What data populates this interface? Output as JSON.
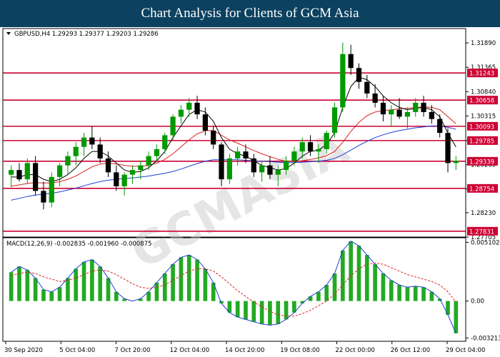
{
  "header": {
    "title": "Chart Analysis for Clients of GCM Asia"
  },
  "watermark": "GCMASIA",
  "colors": {
    "banner": "#0c4160",
    "bull": "#009900",
    "bear": "#000000",
    "sr": "#cc0033",
    "ma_fast": "#000000",
    "ma_mid": "#dd2222",
    "ma_slow": "#1f3fd6",
    "macd": "#1f3fd6",
    "signal": "#dd2222",
    "hist": "#22aa22"
  },
  "chart_data": [
    {
      "type": "candlestick",
      "symbol_label": "GBPUSD,H4  1.29293 1.29377 1.29203 1.29286",
      "ylim": [
        1.27705,
        1.322
      ],
      "y_ticks": [
        "1.31890",
        "1.31365",
        "1.30840",
        "1.30315",
        "1.29785",
        "1.29265",
        "1.28740",
        "1.28230",
        "1.27705"
      ],
      "sr_levels": [
        {
          "value": 1.31243,
          "label": "1.31243"
        },
        {
          "value": 1.30658,
          "label": "1.30658"
        },
        {
          "value": 1.30093,
          "label": "1.30093"
        },
        {
          "value": 1.29785,
          "label": "1.29785"
        },
        {
          "value": 1.29339,
          "label": "1.29339"
        },
        {
          "value": 1.28754,
          "label": "1.28754"
        },
        {
          "value": 1.27831,
          "label": "1.27831"
        }
      ],
      "x_labels": [
        "30 Sep 2020",
        "5 Oct 04:00",
        "7 Oct 20:00",
        "12 Oct 04:00",
        "14 Oct 20:00",
        "19 Oct 08:00",
        "22 Oct 00:00",
        "26 Oct 12:00",
        "29 Oct 04:00"
      ],
      "candles": [
        [
          1.2905,
          1.2925,
          1.2878,
          1.2915
        ],
        [
          1.2915,
          1.293,
          1.289,
          1.2895
        ],
        [
          1.2895,
          1.294,
          1.2885,
          1.293
        ],
        [
          1.293,
          1.2945,
          1.286,
          1.287
        ],
        [
          1.287,
          1.289,
          1.283,
          1.2845
        ],
        [
          1.2845,
          1.291,
          1.2835,
          1.29
        ],
        [
          1.29,
          1.293,
          1.288,
          1.2925
        ],
        [
          1.2925,
          1.2955,
          1.2905,
          1.2945
        ],
        [
          1.2945,
          1.2975,
          1.2925,
          1.2965
        ],
        [
          1.2965,
          1.2995,
          1.2945,
          1.2985
        ],
        [
          1.2985,
          1.301,
          1.296,
          1.297
        ],
        [
          1.297,
          1.2985,
          1.293,
          1.294
        ],
        [
          1.294,
          1.2955,
          1.29,
          1.291
        ],
        [
          1.291,
          1.2925,
          1.287,
          1.288
        ],
        [
          1.288,
          1.291,
          1.286,
          1.2905
        ],
        [
          1.2905,
          1.2925,
          1.2885,
          1.2915
        ],
        [
          1.2915,
          1.2935,
          1.2895,
          1.2925
        ],
        [
          1.2925,
          1.2955,
          1.2915,
          1.2945
        ],
        [
          1.2945,
          1.297,
          1.2935,
          1.296
        ],
        [
          1.296,
          1.2995,
          1.295,
          1.299
        ],
        [
          1.299,
          1.3035,
          1.298,
          1.303
        ],
        [
          1.303,
          1.3055,
          1.3015,
          1.3045
        ],
        [
          1.3045,
          1.307,
          1.303,
          1.306
        ],
        [
          1.306,
          1.3075,
          1.3025,
          1.3035
        ],
        [
          1.3035,
          1.305,
          1.299,
          1.3
        ],
        [
          1.3,
          1.301,
          1.296,
          1.297
        ],
        [
          1.297,
          1.2975,
          1.288,
          1.2895
        ],
        [
          1.2895,
          1.295,
          1.2885,
          1.294
        ],
        [
          1.294,
          1.2965,
          1.2925,
          1.2955
        ],
        [
          1.2955,
          1.297,
          1.293,
          1.294
        ],
        [
          1.294,
          1.295,
          1.29,
          1.291
        ],
        [
          1.291,
          1.2935,
          1.289,
          1.2925
        ],
        [
          1.2925,
          1.2945,
          1.2895,
          1.2905
        ],
        [
          1.2905,
          1.2925,
          1.288,
          1.2915
        ],
        [
          1.2915,
          1.2945,
          1.2905,
          1.2935
        ],
        [
          1.2935,
          1.2965,
          1.2925,
          1.2955
        ],
        [
          1.2955,
          1.2985,
          1.294,
          1.2975
        ],
        [
          1.2975,
          1.299,
          1.2945,
          1.2955
        ],
        [
          1.2955,
          1.297,
          1.293,
          1.296
        ],
        [
          1.296,
          1.3,
          1.295,
          1.2995
        ],
        [
          1.2995,
          1.306,
          1.2985,
          1.305
        ],
        [
          1.305,
          1.319,
          1.304,
          1.3165
        ],
        [
          1.3165,
          1.3185,
          1.312,
          1.3135
        ],
        [
          1.3135,
          1.3145,
          1.309,
          1.3105
        ],
        [
          1.3105,
          1.312,
          1.307,
          1.308
        ],
        [
          1.308,
          1.31,
          1.305,
          1.306
        ],
        [
          1.306,
          1.3075,
          1.302,
          1.3035
        ],
        [
          1.3035,
          1.3055,
          1.301,
          1.3045
        ],
        [
          1.3045,
          1.307,
          1.3025,
          1.303
        ],
        [
          1.303,
          1.305,
          1.3005,
          1.304
        ],
        [
          1.304,
          1.307,
          1.303,
          1.306
        ],
        [
          1.306,
          1.3075,
          1.303,
          1.304
        ],
        [
          1.304,
          1.3055,
          1.3015,
          1.3025
        ],
        [
          1.3025,
          1.3035,
          1.2985,
          1.2995
        ],
        [
          1.2995,
          1.3005,
          1.291,
          1.293
        ],
        [
          1.293,
          1.2945,
          1.2915,
          1.2935
        ]
      ],
      "ma_fast": [
        1.29,
        1.29,
        1.2905,
        1.2905,
        1.2895,
        1.289,
        1.2895,
        1.2905,
        1.292,
        1.294,
        1.2955,
        1.2955,
        1.2945,
        1.293,
        1.2915,
        1.291,
        1.2912,
        1.292,
        1.2935,
        1.2955,
        1.2985,
        1.301,
        1.3035,
        1.3045,
        1.304,
        1.302,
        1.2985,
        1.296,
        1.295,
        1.2945,
        1.2935,
        1.2925,
        1.292,
        1.2915,
        1.2918,
        1.293,
        1.2945,
        1.2955,
        1.2958,
        1.297,
        1.2995,
        1.305,
        1.3095,
        1.3115,
        1.311,
        1.3095,
        1.3075,
        1.306,
        1.305,
        1.3045,
        1.3048,
        1.305,
        1.3045,
        1.303,
        1.2995,
        1.2965
      ],
      "ma_mid": [
        1.288,
        1.2883,
        1.2886,
        1.2888,
        1.2887,
        1.2887,
        1.289,
        1.2895,
        1.2902,
        1.2912,
        1.2922,
        1.2928,
        1.293,
        1.2928,
        1.2925,
        1.2923,
        1.2923,
        1.2925,
        1.293,
        1.2938,
        1.295,
        1.2965,
        1.298,
        1.2993,
        1.3,
        1.3,
        1.299,
        1.298,
        1.2973,
        1.2965,
        1.2957,
        1.295,
        1.2944,
        1.2938,
        1.2934,
        1.2933,
        1.2935,
        1.2938,
        1.2941,
        1.2946,
        1.2955,
        1.2975,
        1.2998,
        1.3018,
        1.3032,
        1.304,
        1.3043,
        1.3045,
        1.3047,
        1.3048,
        1.305,
        1.3051,
        1.305,
        1.3045,
        1.303,
        1.3015
      ],
      "ma_slow": [
        1.285,
        1.2854,
        1.2858,
        1.2861,
        1.2863,
        1.2865,
        1.2868,
        1.2872,
        1.2876,
        1.2881,
        1.2886,
        1.289,
        1.2893,
        1.2895,
        1.2897,
        1.2898,
        1.29,
        1.2902,
        1.2905,
        1.2908,
        1.2912,
        1.2917,
        1.2923,
        1.2929,
        1.2934,
        1.2937,
        1.2937,
        1.2937,
        1.2937,
        1.2936,
        1.2935,
        1.2934,
        1.2933,
        1.2932,
        1.2931,
        1.2931,
        1.2932,
        1.2933,
        1.2934,
        1.2936,
        1.294,
        1.2948,
        1.2958,
        1.2968,
        1.2977,
        1.2985,
        1.2991,
        1.2996,
        1.3,
        1.3003,
        1.3006,
        1.3008,
        1.301,
        1.301,
        1.3007,
        1.3003
      ]
    },
    {
      "type": "macd",
      "label": "MACD(12,26,9) -0.002835 -0.001960 -0.000875",
      "ylim": [
        -0.0035,
        0.0055
      ],
      "y_ticks": [
        {
          "value": 0.005102,
          "label": "0.005102"
        },
        {
          "value": 0.0,
          "label": "0.00"
        },
        {
          "value": -0.003213,
          "label": "-0.003213"
        }
      ],
      "macd": [
        0.0025,
        0.003,
        0.0027,
        0.002,
        0.001,
        0.0008,
        0.0012,
        0.002,
        0.0028,
        0.0034,
        0.0036,
        0.003,
        0.002,
        0.0008,
        0.0002,
        0.0,
        0.0002,
        0.0008,
        0.0016,
        0.0024,
        0.0032,
        0.0038,
        0.004,
        0.0036,
        0.0028,
        0.0016,
        -0.0002,
        -0.001,
        -0.0014,
        -0.0016,
        -0.0018,
        -0.002,
        -0.0021,
        -0.002,
        -0.0016,
        -0.001,
        -0.0002,
        0.0004,
        0.0008,
        0.0014,
        0.0024,
        0.0044,
        0.0052,
        0.0048,
        0.004,
        0.0032,
        0.0024,
        0.0018,
        0.0014,
        0.0012,
        0.0013,
        0.0012,
        0.0008,
        0.0002,
        -0.0012,
        -0.0028
      ],
      "signal": [
        0.0022,
        0.0024,
        0.0025,
        0.0024,
        0.0021,
        0.0019,
        0.0017,
        0.0018,
        0.002,
        0.0023,
        0.0026,
        0.0027,
        0.0026,
        0.0023,
        0.0019,
        0.0015,
        0.0012,
        0.0011,
        0.0012,
        0.0014,
        0.0018,
        0.0022,
        0.0026,
        0.0028,
        0.0028,
        0.0026,
        0.0021,
        0.0015,
        0.0009,
        0.0004,
        -0.0001,
        -0.0005,
        -0.0009,
        -0.0012,
        -0.0013,
        -0.0013,
        -0.0011,
        -0.0008,
        -0.0004,
        0.0,
        0.0006,
        0.0014,
        0.0022,
        0.0028,
        0.0032,
        0.0033,
        0.0032,
        0.0029,
        0.0026,
        0.0023,
        0.0021,
        0.0019,
        0.0017,
        0.0014,
        0.0008,
        -0.0001
      ]
    }
  ]
}
